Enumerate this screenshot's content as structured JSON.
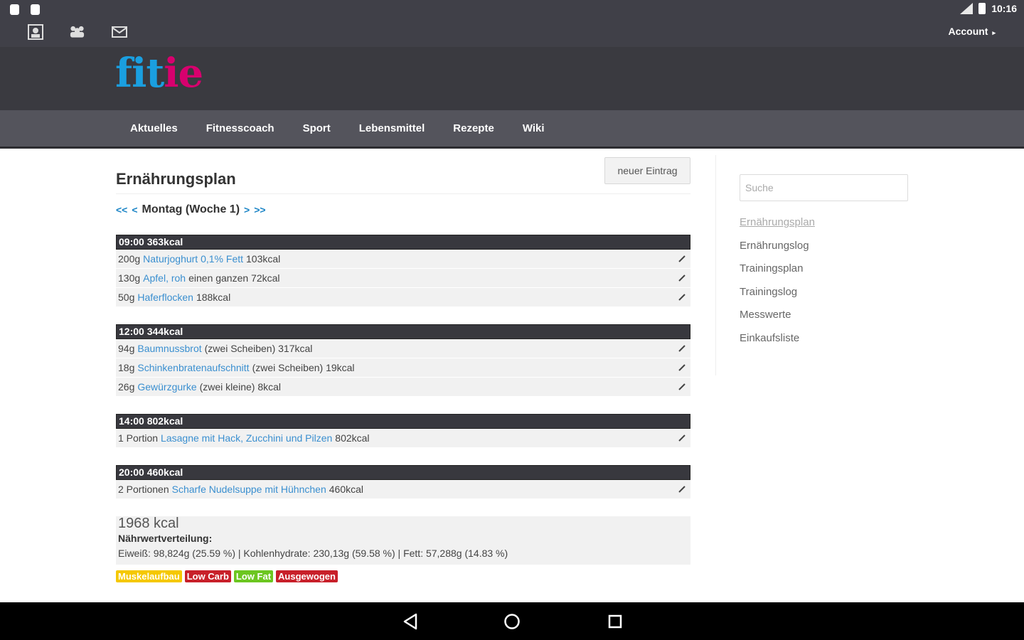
{
  "status_bar": {
    "time": "10:16"
  },
  "toolbar": {
    "icons": [
      "contact-card-icon",
      "group-icon",
      "mail-icon"
    ],
    "account_label": "Account"
  },
  "logo": {
    "part1": "fit",
    "part2": "i",
    "part3": "e"
  },
  "nav": [
    "Aktuelles",
    "Fitnesscoach",
    "Sport",
    "Lebensmittel",
    "Rezepte",
    "Wiki"
  ],
  "main": {
    "title": "Ernährungsplan",
    "new_entry_label": "neuer Eintrag",
    "daynav": {
      "first": "<<",
      "prev": "<",
      "day": "Montag (Woche 1)",
      "next": ">",
      "last": ">>"
    },
    "meals": [
      {
        "header": "09:00 363kcal",
        "items": [
          {
            "pre": "200g",
            "link": "Naturjoghurt 0,1% Fett",
            "post": "103kcal"
          },
          {
            "pre": "130g",
            "link": "Apfel, roh",
            "post": "einen ganzen 72kcal"
          },
          {
            "pre": "50g",
            "link": "Haferflocken",
            "post": "188kcal"
          }
        ]
      },
      {
        "header": "12:00 344kcal",
        "items": [
          {
            "pre": "94g",
            "link": "Baumnussbrot",
            "post": "(zwei Scheiben) 317kcal"
          },
          {
            "pre": "18g",
            "link": "Schinkenbratenaufschnitt",
            "post": "(zwei Scheiben) 19kcal"
          },
          {
            "pre": "26g",
            "link": "Gewürzgurke",
            "post": "(zwei kleine) 8kcal"
          }
        ]
      },
      {
        "header": "14:00 802kcal",
        "items": [
          {
            "pre": "1 Portion",
            "link": "Lasagne mit Hack, Zucchini und Pilzen",
            "post": "802kcal"
          }
        ]
      },
      {
        "header": "20:00 460kcal",
        "items": [
          {
            "pre": "2 Portionen",
            "link": "Scharfe Nudelsuppe mit Hühnchen",
            "post": "460kcal"
          }
        ]
      }
    ],
    "summary": {
      "total": "1968 kcal",
      "nv_label": "Nährwertverteilung:",
      "nv_values": "Eiweiß: 98,824g (25.59 %) | Kohlenhydrate: 230,13g (59.58 %) | Fett: 57,288g (14.83 %)"
    },
    "tags": [
      {
        "label": "Muskelaufbau",
        "color": "#f5c800"
      },
      {
        "label": "Low Carb",
        "color": "#c8202a"
      },
      {
        "label": "Low Fat",
        "color": "#6cc620"
      },
      {
        "label": "Ausgewogen",
        "color": "#c8202a"
      }
    ]
  },
  "sidebar": {
    "search_placeholder": "Suche",
    "links": [
      "Ernährungsplan",
      "Ernährungslog",
      "Trainingsplan",
      "Trainingslog",
      "Messwerte",
      "Einkaufsliste"
    ],
    "active_index": 0
  }
}
